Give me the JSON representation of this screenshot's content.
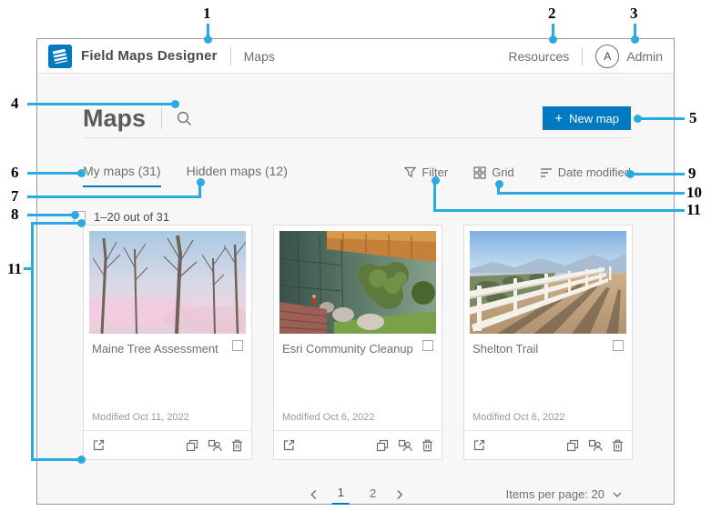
{
  "colors": {
    "accent_blue": "#0079c1",
    "callout_blue": "#29abe2",
    "content_bg": "#f7f7f7"
  },
  "callouts": {
    "n1": "1",
    "n2": "2",
    "n3": "3",
    "n4": "4",
    "n5": "5",
    "n6": "6",
    "n7": "7",
    "n8": "8",
    "n9": "9",
    "n10": "10",
    "n11": "11"
  },
  "header": {
    "app_title": "Field Maps Designer",
    "nav_item": "Maps",
    "resources_label": "Resources",
    "avatar_initial": "A",
    "user_name": "Admin"
  },
  "toolbar": {
    "page_title": "Maps",
    "plus_glyph": "+",
    "new_map_label": "New map"
  },
  "tabs": {
    "my_maps_label": "My maps (31)",
    "hidden_maps_label": "Hidden maps (12)"
  },
  "list_controls": {
    "filter_label": "Filter",
    "grid_label": "Grid",
    "sort_label": "Date modified"
  },
  "selection_bar": {
    "range_label": "1–20 out of 31"
  },
  "cards": [
    {
      "title": "Maine Tree Assessment",
      "modified": "Modified Oct 11, 2022"
    },
    {
      "title": "Esri Community Cleanup",
      "modified": "Modified Oct 6, 2022"
    },
    {
      "title": "Shelton Trail",
      "modified": "Modified Oct 6, 2022"
    }
  ],
  "pagination": {
    "page_1": "1",
    "page_2": "2",
    "items_per_page_label": "Items per page: 20"
  }
}
